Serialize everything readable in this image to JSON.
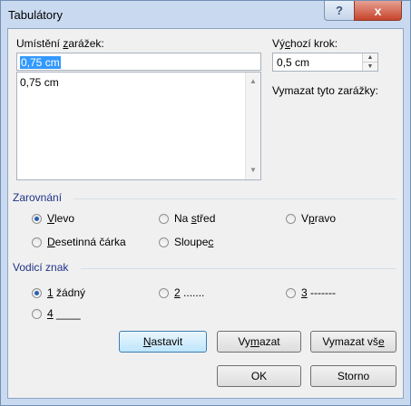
{
  "window": {
    "title": "Tabulátory"
  },
  "titlebar": {
    "help_glyph": "?",
    "close_glyph": "x"
  },
  "tabstops": {
    "label_pre": "Umístění ",
    "label_ul": "z",
    "label_post": "arážek:",
    "value": "0,75 cm",
    "list": [
      "0,75 cm"
    ]
  },
  "default_step": {
    "label_pre": "Vý",
    "label_ul": "c",
    "label_post": "hozí krok:",
    "value": "0,5 cm"
  },
  "clear_label": "Vymazat tyto zarážky:",
  "alignment": {
    "title": "Zarovnání",
    "options": [
      {
        "pre": "",
        "ul": "V",
        "post": "levo",
        "selected": true
      },
      {
        "pre": "Na ",
        "ul": "s",
        "post": "třed",
        "selected": false
      },
      {
        "pre": "V",
        "ul": "p",
        "post": "ravo",
        "selected": false
      },
      {
        "pre": "",
        "ul": "D",
        "post": "esetinná čárka",
        "selected": false
      },
      {
        "pre": "Sloupe",
        "ul": "c",
        "post": "",
        "selected": false
      }
    ]
  },
  "leader": {
    "title": "Vodicí znak",
    "options": [
      {
        "pre": "",
        "ul": "1",
        "post": " žádný",
        "selected": true
      },
      {
        "pre": "",
        "ul": "2",
        "post": " .......",
        "selected": false
      },
      {
        "pre": "",
        "ul": "3",
        "post": " -------",
        "selected": false
      },
      {
        "pre": "",
        "ul": "4",
        "post": " ____",
        "selected": false
      }
    ]
  },
  "buttons": {
    "set": {
      "ul": "N",
      "post": "astavit"
    },
    "clear": {
      "pre": "Vy",
      "ul": "m",
      "post": "azat"
    },
    "clear_all": {
      "pre": "Vymazat vš",
      "ul": "e"
    },
    "ok": "OK",
    "cancel": "Storno"
  }
}
